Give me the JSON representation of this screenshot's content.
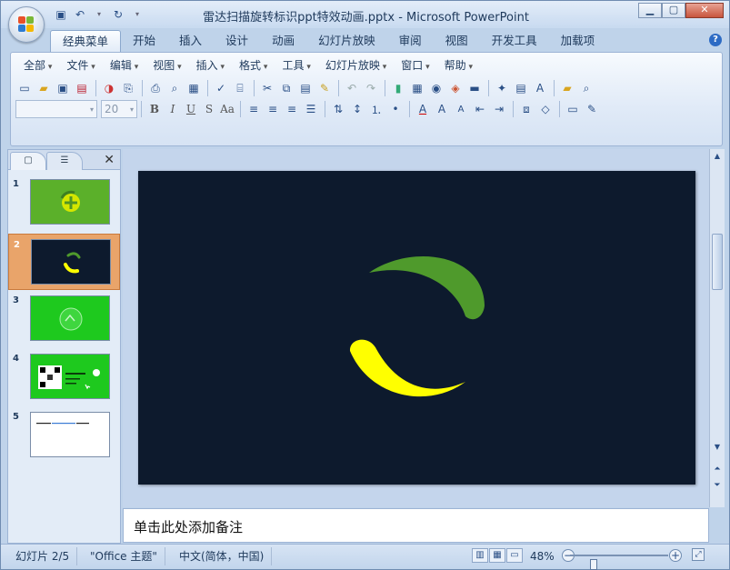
{
  "window": {
    "title": "雷达扫描旋转标识ppt特效动画.pptx - Microsoft PowerPoint",
    "controls": [
      "minimize",
      "maximize",
      "close"
    ]
  },
  "quick_access": [
    "save-icon",
    "undo-icon",
    "redo-icon",
    "customize-icon"
  ],
  "ribbon": {
    "tabs": [
      {
        "label": "经典菜单",
        "active": true
      },
      {
        "label": "开始"
      },
      {
        "label": "插入"
      },
      {
        "label": "设计"
      },
      {
        "label": "动画"
      },
      {
        "label": "幻灯片放映"
      },
      {
        "label": "审阅"
      },
      {
        "label": "视图"
      },
      {
        "label": "开发工具"
      },
      {
        "label": "加载项"
      }
    ],
    "menus": [
      "全部",
      "文件",
      "编辑",
      "视图",
      "插入",
      "格式",
      "工具",
      "幻灯片放映",
      "窗口",
      "帮助"
    ],
    "font_size_value": "20"
  },
  "slides_panel": {
    "thumbnails": [
      {
        "num": "1",
        "bg": "#5bb02a"
      },
      {
        "num": "2",
        "bg": "#0d1a2d",
        "selected": true
      },
      {
        "num": "3",
        "bg": "#1ec91e"
      },
      {
        "num": "4",
        "bg": "#1ec91e"
      },
      {
        "num": "5",
        "bg": "#ffffff"
      }
    ]
  },
  "slide": {
    "background": "#0d1a2d",
    "arc_green": "#4f9a2c",
    "arc_yellow": "#ffff00"
  },
  "notes": {
    "placeholder": "单击此处添加备注"
  },
  "status_bar": {
    "slide_info": "幻灯片 2/5",
    "theme": "\"Office 主题\"",
    "language": "中文(简体，中国)",
    "zoom": "48%",
    "zoom_level": 0.48
  }
}
